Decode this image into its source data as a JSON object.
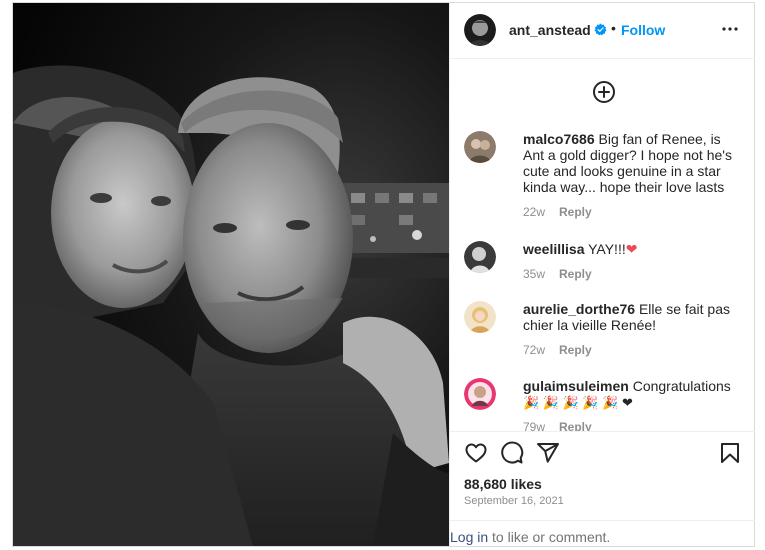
{
  "post": {
    "photo_alt": "",
    "header": {
      "username": "ant_anstead",
      "dot": "•",
      "follow_label": "Follow"
    },
    "comments": [
      {
        "username": "malco7686",
        "text": "Big fan of Renee, is Ant a gold digger? I hope not he's cute and looks genuine in a star kinda way... hope their love lasts",
        "time": "22w",
        "reply_label": "Reply"
      },
      {
        "username": "weelillisa",
        "text": "YAY!!!",
        "emoji": "❤",
        "time": "35w",
        "reply_label": "Reply"
      },
      {
        "username": "aurelie_dorthe76",
        "text": "Elle se fait pas chier la vieille Renée!",
        "time": "72w",
        "reply_label": "Reply"
      },
      {
        "username": "gulaimsuleimen",
        "text": "Congratulations",
        "emoji": "🎉 🎉 🎉 🎉 🎉 ❤",
        "time": "79w",
        "reply_label": "Reply"
      }
    ],
    "likes": "88,680 likes",
    "date": "September 16, 2021",
    "footer": {
      "login_link": "Log in",
      "login_rest": " to like or comment."
    }
  },
  "colors": {
    "link_blue": "#0095f6",
    "verified_blue": "#0095f6",
    "login_link": "#385185",
    "heart_red": "#ed4956",
    "muted_text": "#8e8e8e",
    "border": "#dbdbdb"
  },
  "icons": {
    "verified": "verified-badge-icon",
    "more": "more-options-icon",
    "add_comment": "plus-circle-icon",
    "like": "heart-icon",
    "comment": "comment-bubble-icon",
    "share": "paper-plane-icon",
    "save": "bookmark-icon"
  }
}
